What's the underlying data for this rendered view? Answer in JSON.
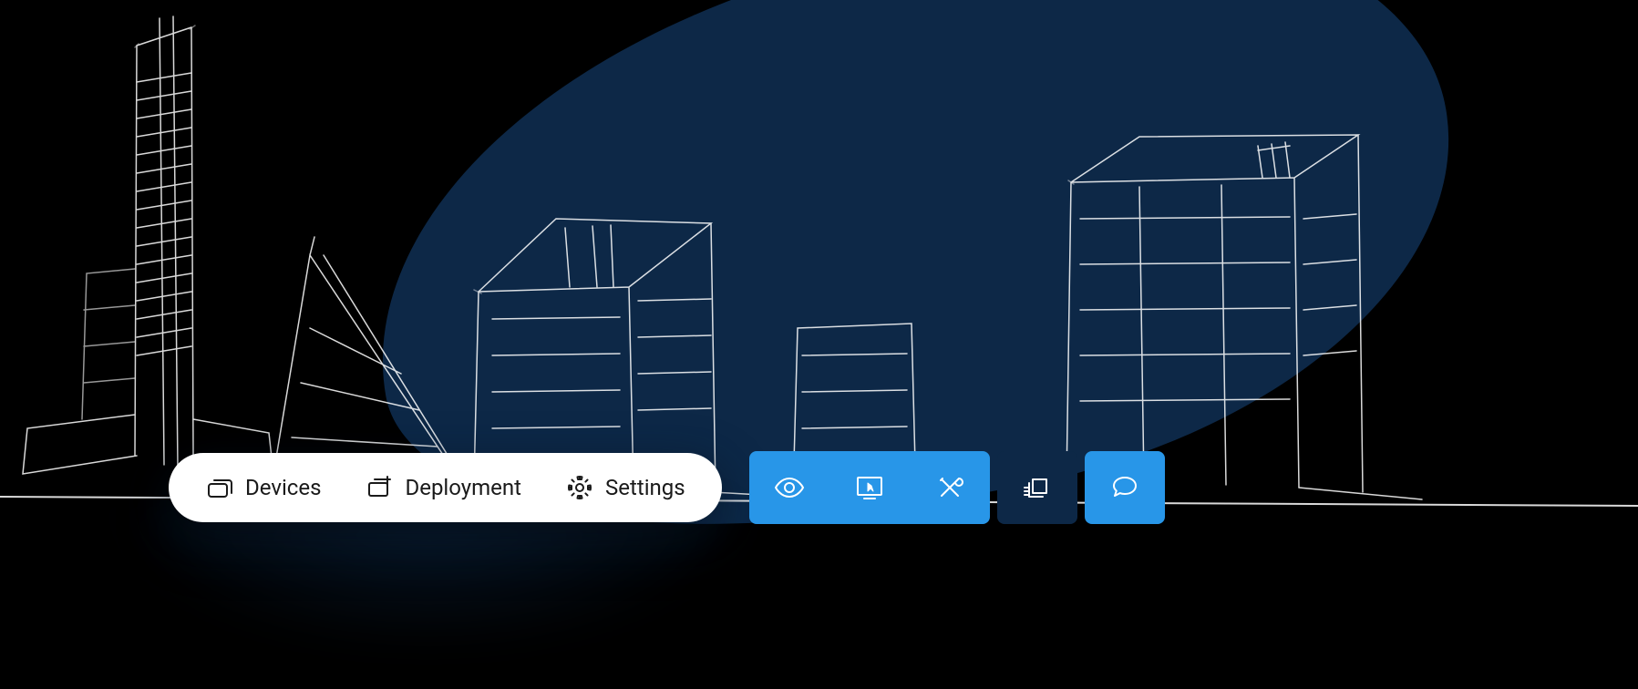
{
  "white_toolbar": {
    "items": [
      {
        "label": "Devices",
        "icon": "devices-icon"
      },
      {
        "label": "Deployment",
        "icon": "deployment-icon"
      },
      {
        "label": "Settings",
        "icon": "gear-icon"
      }
    ]
  },
  "blue_toolbar": {
    "segments": [
      {
        "style": "light",
        "items": [
          {
            "icon": "eye-icon"
          },
          {
            "icon": "monitor-cursor-icon"
          },
          {
            "icon": "tools-icon"
          }
        ]
      },
      {
        "style": "dark",
        "items": [
          {
            "icon": "layers-icon"
          }
        ]
      },
      {
        "style": "light",
        "items": [
          {
            "icon": "chat-icon"
          }
        ]
      }
    ]
  },
  "colors": {
    "primary_blue": "#2896e8",
    "dark_blue": "#0d2847",
    "white": "#ffffff",
    "black": "#000000"
  }
}
